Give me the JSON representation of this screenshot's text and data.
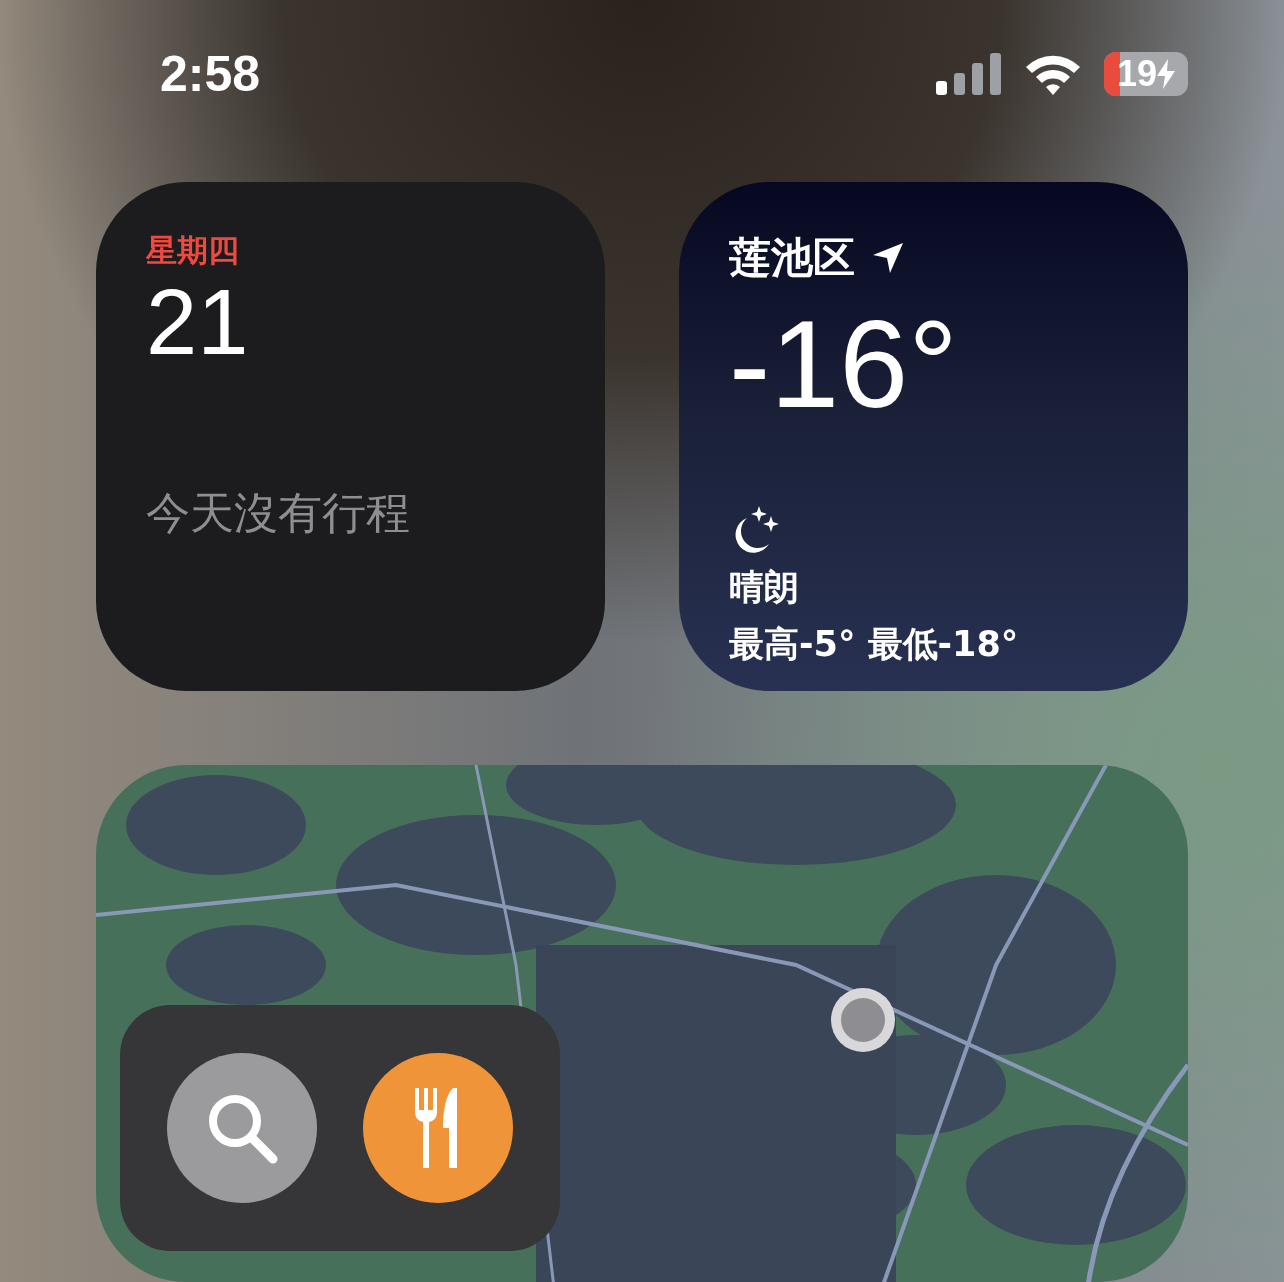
{
  "status_bar": {
    "time": "2:58",
    "battery": {
      "text": "19",
      "level": 0.19,
      "charging": true
    }
  },
  "calendar_widget": {
    "weekday": "星期四",
    "day": "21",
    "message": "今天沒有行程"
  },
  "weather_widget": {
    "location": "莲池区",
    "temperature": "-16°",
    "condition": "晴朗",
    "range": "最高-5° 最低-18°"
  },
  "maps_widget": {
    "actions": [
      {
        "kind": "search"
      },
      {
        "kind": "restaurant"
      }
    ]
  }
}
